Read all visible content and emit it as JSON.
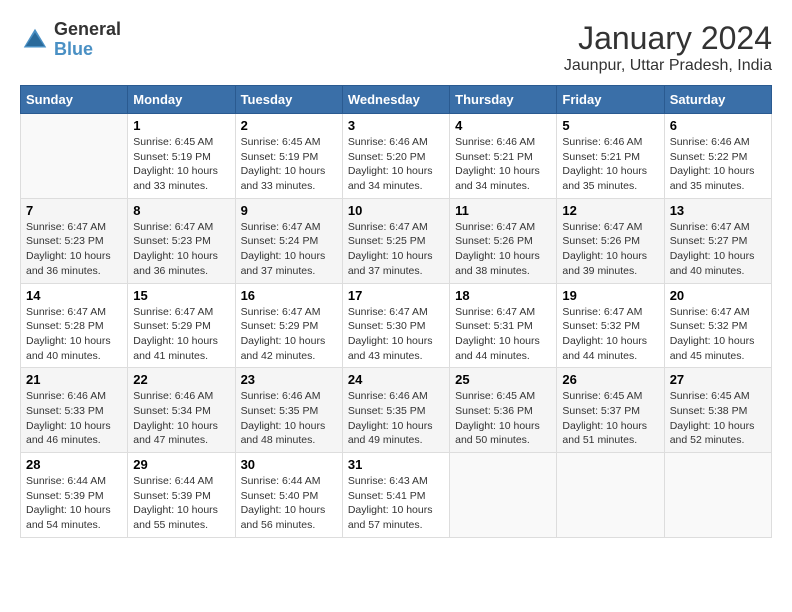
{
  "header": {
    "logo_line1": "General",
    "logo_line2": "Blue",
    "title": "January 2024",
    "subtitle": "Jaunpur, Uttar Pradesh, India"
  },
  "days_of_week": [
    "Sunday",
    "Monday",
    "Tuesday",
    "Wednesday",
    "Thursday",
    "Friday",
    "Saturday"
  ],
  "weeks": [
    [
      {
        "day": "",
        "info": ""
      },
      {
        "day": "1",
        "info": "Sunrise: 6:45 AM\nSunset: 5:19 PM\nDaylight: 10 hours\nand 33 minutes."
      },
      {
        "day": "2",
        "info": "Sunrise: 6:45 AM\nSunset: 5:19 PM\nDaylight: 10 hours\nand 33 minutes."
      },
      {
        "day": "3",
        "info": "Sunrise: 6:46 AM\nSunset: 5:20 PM\nDaylight: 10 hours\nand 34 minutes."
      },
      {
        "day": "4",
        "info": "Sunrise: 6:46 AM\nSunset: 5:21 PM\nDaylight: 10 hours\nand 34 minutes."
      },
      {
        "day": "5",
        "info": "Sunrise: 6:46 AM\nSunset: 5:21 PM\nDaylight: 10 hours\nand 35 minutes."
      },
      {
        "day": "6",
        "info": "Sunrise: 6:46 AM\nSunset: 5:22 PM\nDaylight: 10 hours\nand 35 minutes."
      }
    ],
    [
      {
        "day": "7",
        "info": "Sunrise: 6:47 AM\nSunset: 5:23 PM\nDaylight: 10 hours\nand 36 minutes."
      },
      {
        "day": "8",
        "info": "Sunrise: 6:47 AM\nSunset: 5:23 PM\nDaylight: 10 hours\nand 36 minutes."
      },
      {
        "day": "9",
        "info": "Sunrise: 6:47 AM\nSunset: 5:24 PM\nDaylight: 10 hours\nand 37 minutes."
      },
      {
        "day": "10",
        "info": "Sunrise: 6:47 AM\nSunset: 5:25 PM\nDaylight: 10 hours\nand 37 minutes."
      },
      {
        "day": "11",
        "info": "Sunrise: 6:47 AM\nSunset: 5:26 PM\nDaylight: 10 hours\nand 38 minutes."
      },
      {
        "day": "12",
        "info": "Sunrise: 6:47 AM\nSunset: 5:26 PM\nDaylight: 10 hours\nand 39 minutes."
      },
      {
        "day": "13",
        "info": "Sunrise: 6:47 AM\nSunset: 5:27 PM\nDaylight: 10 hours\nand 40 minutes."
      }
    ],
    [
      {
        "day": "14",
        "info": "Sunrise: 6:47 AM\nSunset: 5:28 PM\nDaylight: 10 hours\nand 40 minutes."
      },
      {
        "day": "15",
        "info": "Sunrise: 6:47 AM\nSunset: 5:29 PM\nDaylight: 10 hours\nand 41 minutes."
      },
      {
        "day": "16",
        "info": "Sunrise: 6:47 AM\nSunset: 5:29 PM\nDaylight: 10 hours\nand 42 minutes."
      },
      {
        "day": "17",
        "info": "Sunrise: 6:47 AM\nSunset: 5:30 PM\nDaylight: 10 hours\nand 43 minutes."
      },
      {
        "day": "18",
        "info": "Sunrise: 6:47 AM\nSunset: 5:31 PM\nDaylight: 10 hours\nand 44 minutes."
      },
      {
        "day": "19",
        "info": "Sunrise: 6:47 AM\nSunset: 5:32 PM\nDaylight: 10 hours\nand 44 minutes."
      },
      {
        "day": "20",
        "info": "Sunrise: 6:47 AM\nSunset: 5:32 PM\nDaylight: 10 hours\nand 45 minutes."
      }
    ],
    [
      {
        "day": "21",
        "info": "Sunrise: 6:46 AM\nSunset: 5:33 PM\nDaylight: 10 hours\nand 46 minutes."
      },
      {
        "day": "22",
        "info": "Sunrise: 6:46 AM\nSunset: 5:34 PM\nDaylight: 10 hours\nand 47 minutes."
      },
      {
        "day": "23",
        "info": "Sunrise: 6:46 AM\nSunset: 5:35 PM\nDaylight: 10 hours\nand 48 minutes."
      },
      {
        "day": "24",
        "info": "Sunrise: 6:46 AM\nSunset: 5:35 PM\nDaylight: 10 hours\nand 49 minutes."
      },
      {
        "day": "25",
        "info": "Sunrise: 6:45 AM\nSunset: 5:36 PM\nDaylight: 10 hours\nand 50 minutes."
      },
      {
        "day": "26",
        "info": "Sunrise: 6:45 AM\nSunset: 5:37 PM\nDaylight: 10 hours\nand 51 minutes."
      },
      {
        "day": "27",
        "info": "Sunrise: 6:45 AM\nSunset: 5:38 PM\nDaylight: 10 hours\nand 52 minutes."
      }
    ],
    [
      {
        "day": "28",
        "info": "Sunrise: 6:44 AM\nSunset: 5:39 PM\nDaylight: 10 hours\nand 54 minutes."
      },
      {
        "day": "29",
        "info": "Sunrise: 6:44 AM\nSunset: 5:39 PM\nDaylight: 10 hours\nand 55 minutes."
      },
      {
        "day": "30",
        "info": "Sunrise: 6:44 AM\nSunset: 5:40 PM\nDaylight: 10 hours\nand 56 minutes."
      },
      {
        "day": "31",
        "info": "Sunrise: 6:43 AM\nSunset: 5:41 PM\nDaylight: 10 hours\nand 57 minutes."
      },
      {
        "day": "",
        "info": ""
      },
      {
        "day": "",
        "info": ""
      },
      {
        "day": "",
        "info": ""
      }
    ]
  ]
}
